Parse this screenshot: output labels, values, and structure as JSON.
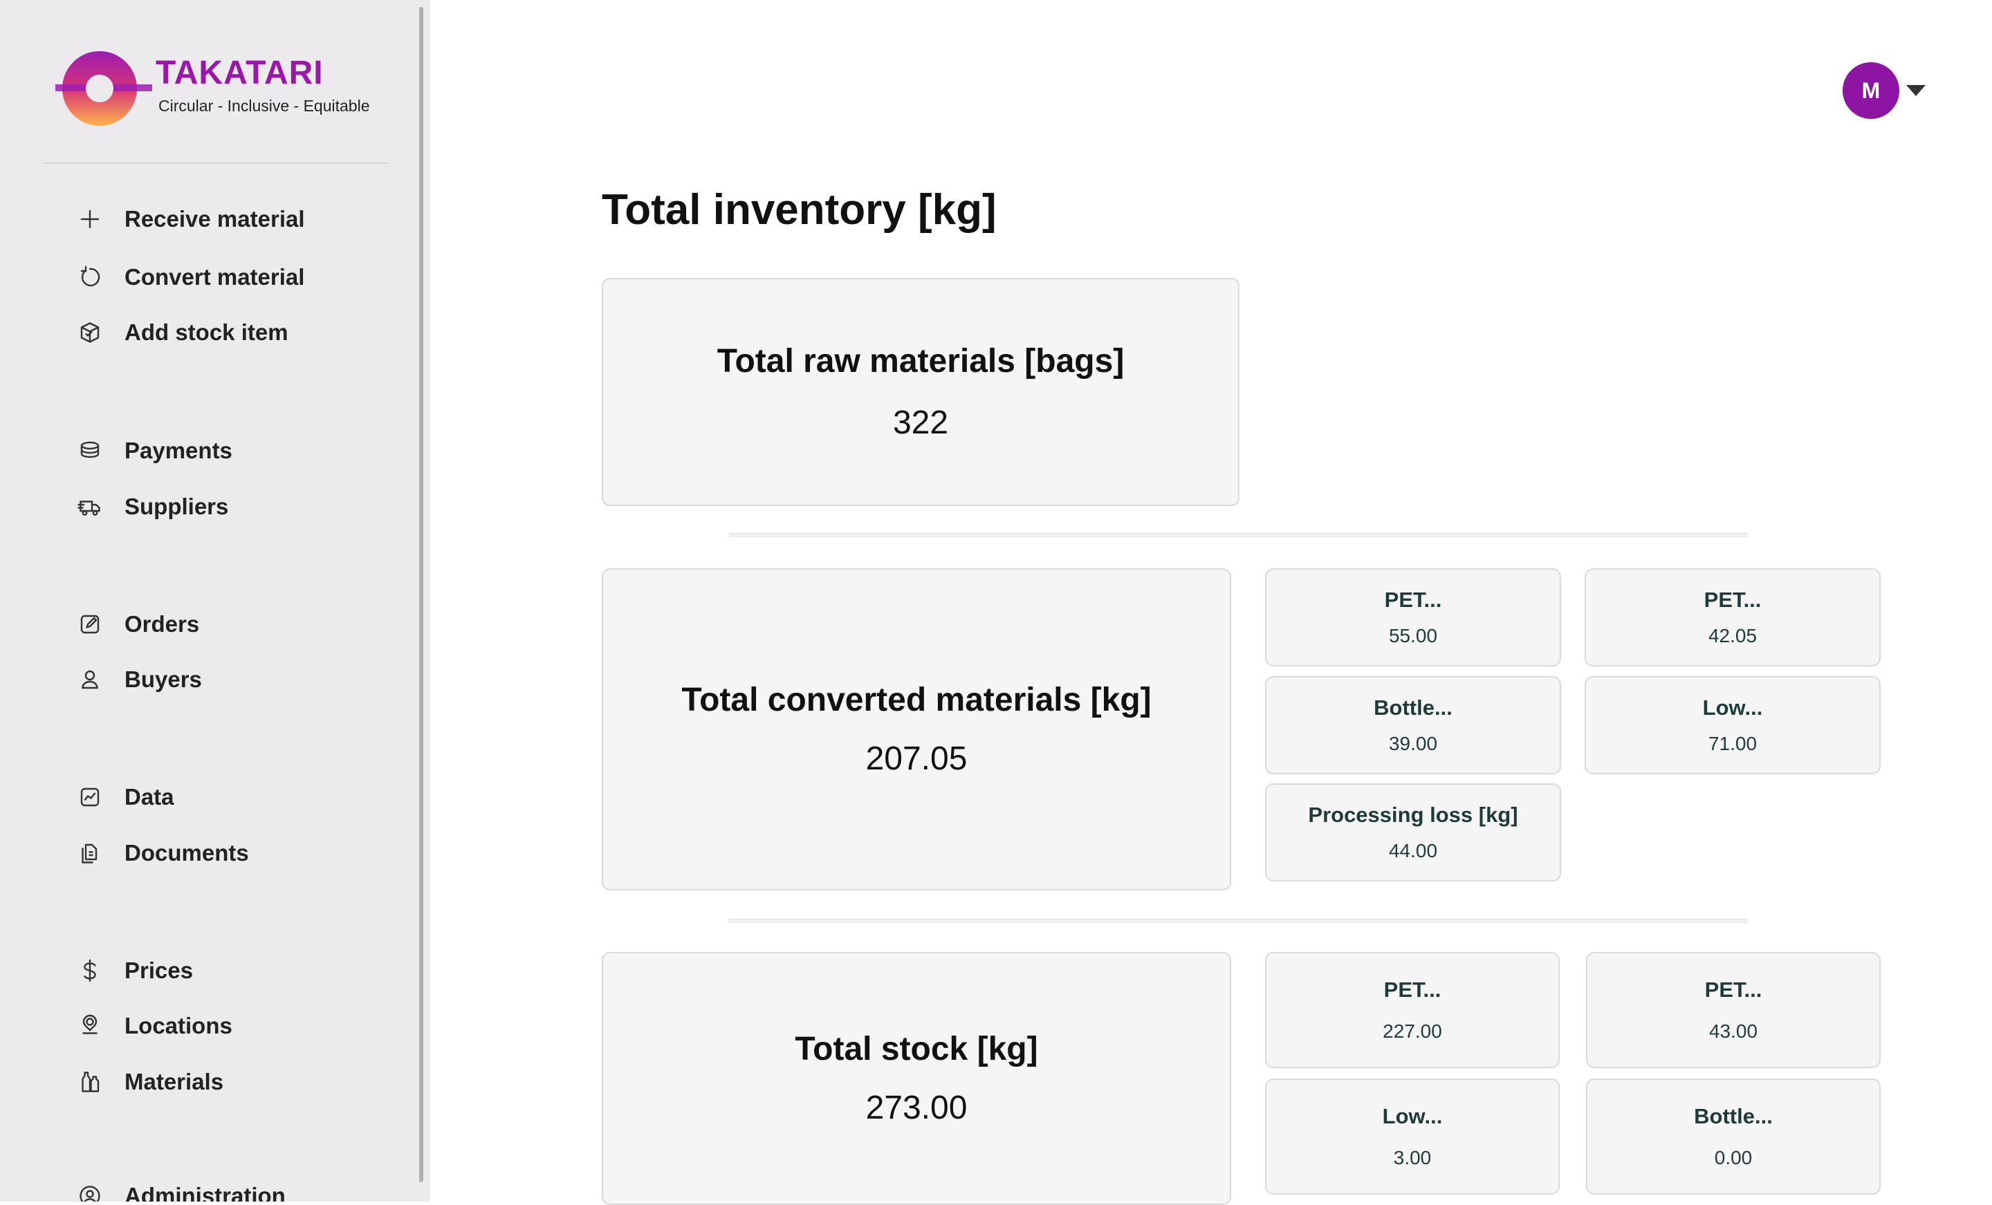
{
  "brand": {
    "name": "TAKATARI",
    "tagline": "Circular - Inclusive - Equitable"
  },
  "sidebar": {
    "items": [
      {
        "label": "Receive material",
        "icon": "plus-icon"
      },
      {
        "label": "Convert material",
        "icon": "refresh-icon"
      },
      {
        "label": "Add stock item",
        "icon": "box-icon"
      },
      {
        "label": "Payments",
        "icon": "coins-icon"
      },
      {
        "label": "Suppliers",
        "icon": "truck-icon"
      },
      {
        "label": "Orders",
        "icon": "edit-icon"
      },
      {
        "label": "Buyers",
        "icon": "user-icon"
      },
      {
        "label": "Data",
        "icon": "chart-icon"
      },
      {
        "label": "Documents",
        "icon": "documents-icon"
      },
      {
        "label": "Prices",
        "icon": "dollar-icon"
      },
      {
        "label": "Locations",
        "icon": "location-icon"
      },
      {
        "label": "Materials",
        "icon": "bottles-icon"
      },
      {
        "label": "Administration",
        "icon": "admin-icon"
      }
    ]
  },
  "header": {
    "avatar_initial": "M"
  },
  "main": {
    "title": "Total inventory [kg]",
    "raw": {
      "title": "Total raw materials [bags]",
      "value": "322"
    },
    "converted": {
      "title": "Total converted materials [kg]",
      "value": "207.05",
      "items": [
        {
          "label": "PET...",
          "value": "55.00"
        },
        {
          "label": "PET...",
          "value": "42.05"
        },
        {
          "label": "Bottle...",
          "value": "39.00"
        },
        {
          "label": "Low...",
          "value": "71.00"
        },
        {
          "label": "Processing loss [kg]",
          "value": "44.00"
        }
      ]
    },
    "stock": {
      "title": "Total stock [kg]",
      "value": "273.00",
      "items": [
        {
          "label": "PET...",
          "value": "227.00"
        },
        {
          "label": "PET...",
          "value": "43.00"
        },
        {
          "label": "Low...",
          "value": "3.00"
        },
        {
          "label": "Bottle...",
          "value": "0.00"
        }
      ]
    }
  },
  "colors": {
    "brand": "#9a18a8",
    "avatar": "#8e14a3",
    "sidebar_bg": "#eceaed",
    "card_bg": "#f5f5f5"
  }
}
